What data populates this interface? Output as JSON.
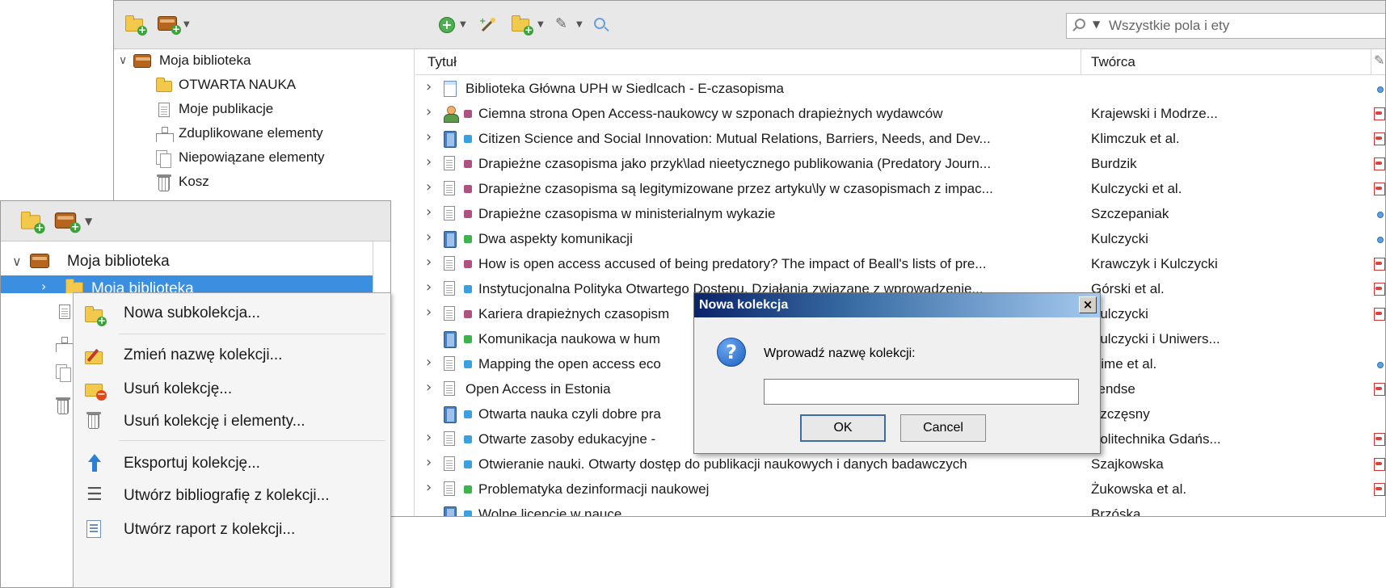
{
  "main": {
    "search": {
      "placeholder": "Wszystkie pola i ety"
    },
    "collections": {
      "library": "Moja biblioteka",
      "children": [
        "OTWARTA NAUKA",
        "Moje publikacje",
        "Zduplikowane elementy",
        "Niepowiązane elementy",
        "Kosz"
      ]
    },
    "items_header": {
      "title": "Tytuł",
      "creator": "Twórca"
    },
    "items": [
      {
        "icon": "web-page",
        "tag": null,
        "title": "Biblioteka Główna UPH w Siedlcach - E-czasopisma",
        "creator": "",
        "attach": "dot",
        "twisty": true
      },
      {
        "icon": "presentation",
        "tag": "#b05080",
        "title": "Ciemna strona Open Access-naukowcy w szponach drapieżnych wydawców",
        "creator": "Krajewski i Modrze...",
        "attach": "pdf",
        "twisty": true
      },
      {
        "icon": "book",
        "tag": "#3aa0e0",
        "title": "Citizen Science and Social Innovation: Mutual Relations, Barriers, Needs, and Dev...",
        "creator": "Klimczuk et al.",
        "attach": "pdf",
        "twisty": true
      },
      {
        "icon": "document",
        "tag": "#b05080",
        "title": "Drapieżne czasopisma jako przyk\\lad nieetycznego publikowania (Predatory Journ...",
        "creator": "Burdzik",
        "attach": "pdf",
        "twisty": true
      },
      {
        "icon": "document",
        "tag": "#b05080",
        "title": "Drapieżne czasopisma są legitymizowane przez artyku\\ly w czasopismach z impac...",
        "creator": "Kulczycki et al.",
        "attach": "pdf",
        "twisty": true
      },
      {
        "icon": "document",
        "tag": "#b05080",
        "title": "Drapieżne czasopisma w ministerialnym wykazie",
        "creator": "Szczepaniak",
        "attach": "dot",
        "twisty": true
      },
      {
        "icon": "book",
        "tag": "#3cb44b",
        "title": "Dwa aspekty komunikacji",
        "creator": "Kulczycki",
        "attach": "dot",
        "twisty": true
      },
      {
        "icon": "document",
        "tag": "#b05080",
        "title": "How is open access accused of being predatory? The impact of Beall's lists of pre...",
        "creator": "Krawczyk i Kulczycki",
        "attach": "pdf",
        "twisty": true
      },
      {
        "icon": "document",
        "tag": "#3aa0e0",
        "title": "Instytucjonalna Polityka Otwartego Dostępu. Działania związane z wprowadzenie...",
        "creator": "Górski et al.",
        "attach": "pdf",
        "twisty": true
      },
      {
        "icon": "document",
        "tag": "#b05080",
        "title": "Kariera drapieżnych czasopism",
        "creator": "Kulczycki",
        "attach": "pdf",
        "twisty": true
      },
      {
        "icon": "book",
        "tag": "#3cb44b",
        "title": "Komunikacja naukowa w hum",
        "creator": "Kulczycki i Uniwers...",
        "attach": "",
        "twisty": false
      },
      {
        "icon": "document",
        "tag": "#3aa0e0",
        "title": "Mapping the open access eco",
        "creator": "Hime et al.",
        "attach": "dot",
        "twisty": true
      },
      {
        "icon": "document",
        "tag": null,
        "title": "Open Access in Estonia",
        "creator": "Tendse",
        "attach": "pdf",
        "twisty": true
      },
      {
        "icon": "book",
        "tag": "#3aa0e0",
        "title": "Otwarta nauka czyli dobre pra",
        "creator": "Szczęsny",
        "attach": "",
        "twisty": false
      },
      {
        "icon": "document",
        "tag": "#3aa0e0",
        "title": "Otwarte zasoby edukacyjne -",
        "creator": "Politechnika Gdańs...",
        "attach": "pdf",
        "twisty": true
      },
      {
        "icon": "document",
        "tag": "#3aa0e0",
        "title": "Otwieranie nauki. Otwarty dostęp do publikacji naukowych i danych badawczych",
        "creator": "Szajkowska",
        "attach": "pdf",
        "twisty": true
      },
      {
        "icon": "document",
        "tag": "#3cb44b",
        "title": "Problematyka dezinformacji naukowej",
        "creator": "Żukowska et al.",
        "attach": "pdf",
        "twisty": true
      },
      {
        "icon": "book",
        "tag": "#3aa0e0",
        "title": "Wolne licencje w nauce",
        "creator": "Brzóska",
        "attach": "",
        "twisty": false
      }
    ]
  },
  "overlay": {
    "library": "Moja biblioteka",
    "selected": "Moja biblioteka",
    "context_menu": [
      "Nowa subkolekcja...",
      "Zmień nazwę kolekcji...",
      "Usuń kolekcję...",
      "Usuń kolekcję i elementy...",
      "Eksportuj kolekcję...",
      "Utwórz bibliografię z kolekcji...",
      "Utwórz raport z kolekcji..."
    ]
  },
  "dialog": {
    "title": "Nowa kolekcja",
    "close": "×",
    "prompt": "Wprowadź nazwę kolekcji:",
    "input_value": "",
    "ok": "OK",
    "cancel": "Cancel",
    "question_mark": "?"
  }
}
